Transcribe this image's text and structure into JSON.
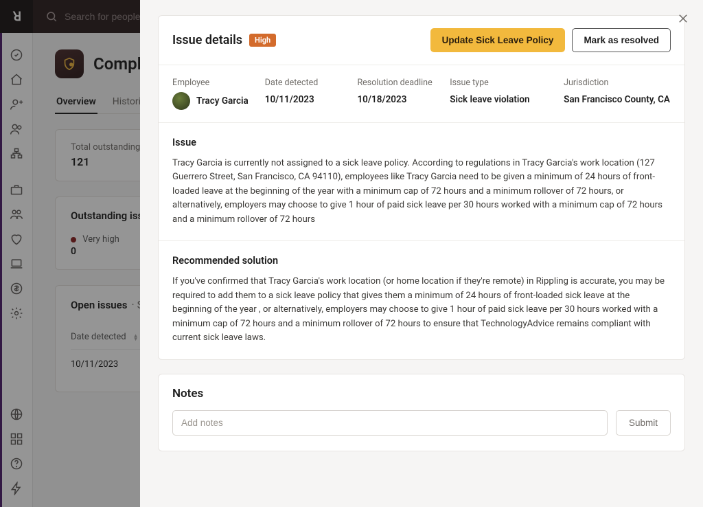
{
  "topbar": {
    "logo_text": "ꓤ",
    "search_placeholder": "Search for people or apps"
  },
  "page": {
    "title": "Compliance",
    "tabs": [
      {
        "label": "Overview",
        "active": true
      },
      {
        "label": "Historical",
        "active": false
      }
    ],
    "summary_card": {
      "label": "Total outstanding issues",
      "value": "121"
    },
    "severity_card": {
      "title": "Outstanding issues",
      "severity_label": "Very high",
      "severity_count": "0"
    },
    "open_issues": {
      "title": "Open issues",
      "subtitle": "· Showing",
      "column": "Date detected",
      "row_date": "10/11/2023"
    }
  },
  "panel": {
    "title": "Issue details",
    "badge": "High",
    "primary_button": "Update Sick Leave Policy",
    "secondary_button": "Mark as resolved",
    "meta": {
      "employee_label": "Employee",
      "employee_name": "Tracy Garcia",
      "detected_label": "Date detected",
      "detected_value": "10/11/2023",
      "deadline_label": "Resolution deadline",
      "deadline_value": "10/18/2023",
      "type_label": "Issue type",
      "type_value": "Sick leave violation",
      "jurisdiction_label": "Jurisdiction",
      "jurisdiction_value": "San Francisco County, CA"
    },
    "issue": {
      "heading": "Issue",
      "body": "Tracy Garcia is currently not assigned to a sick leave policy. According to regulations in Tracy Garcia's work location (127 Guerrero Street, San Francisco, CA 94110), employees like Tracy Garcia need to be given a minimum of 24 hours of front-loaded leave at the beginning of the year with a minimum cap of 72 hours and a minimum rollover of 72 hours, or alternatively, employers may choose to give 1 hour of paid sick leave per 30 hours worked with a minimum cap of 72 hours and a minimum rollover of 72 hours"
    },
    "solution": {
      "heading": "Recommended solution",
      "body": "If you've confirmed that Tracy Garcia's work location (or home location if they're remote) in Rippling is accurate, you may be required to add them to a sick leave policy that gives them a minimum of 24 hours of front-loaded sick leave at the beginning of the year , or alternatively, employers may choose to give 1 hour of paid sick leave per 30 hours worked with a minimum cap of 72 hours and a minimum rollover of 72 hours to ensure that TechnologyAdvice remains compliant with current sick leave laws."
    },
    "notes": {
      "heading": "Notes",
      "placeholder": "Add notes",
      "submit": "Submit"
    }
  }
}
